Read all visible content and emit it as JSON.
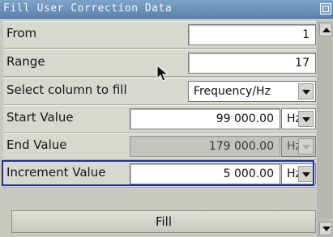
{
  "window": {
    "title": "Fill User Correction Data"
  },
  "rows": {
    "from": {
      "label": "From",
      "value": "1"
    },
    "range": {
      "label": "Range",
      "value": "17"
    },
    "column": {
      "label": "Select column to fill",
      "selected": "Frequency/Hz"
    },
    "start": {
      "label": "Start Value",
      "value": "99 000.00",
      "unit": "Hz"
    },
    "end": {
      "label": "End Value",
      "value": "179 000.00",
      "unit": "Hz"
    },
    "increment": {
      "label": "Increment Value",
      "value": "5 000.00",
      "unit": "Hz"
    }
  },
  "fill_button": {
    "label": "Fill"
  },
  "icons": {
    "cursor": "mouse-pointer-icon",
    "maximize": "maximize-icon",
    "scroll_up": "scroll-up-icon",
    "scroll_down": "scroll-down-icon"
  },
  "colors": {
    "title_bar": "#6f96c0",
    "focus_border": "#1e3390"
  }
}
